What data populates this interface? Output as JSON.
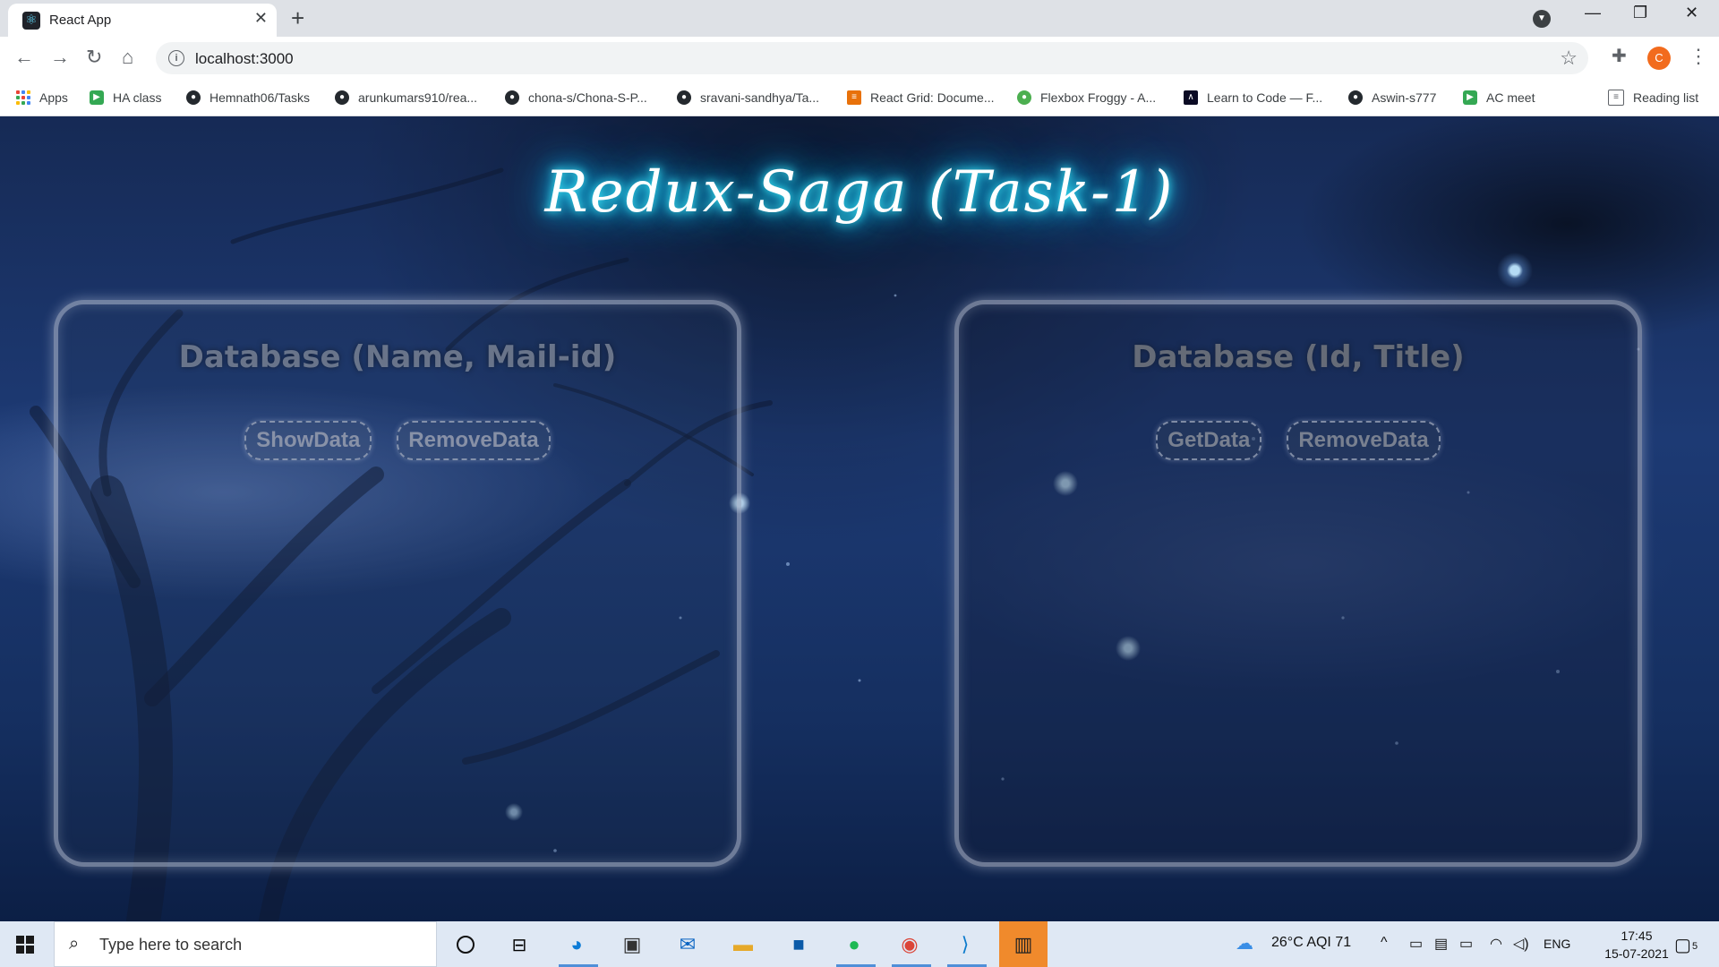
{
  "browser": {
    "tab_title": "React App",
    "tab_close": "✕",
    "new_tab": "+",
    "url": "localhost:3000",
    "profile_initial": "C",
    "window_controls": {
      "minimize": "—",
      "maximize": "❐",
      "close": "✕"
    }
  },
  "bookmarks": {
    "items": [
      {
        "label": "Apps",
        "icon": "apps-grid-icon"
      },
      {
        "label": "HA class",
        "icon": "google-meet-icon"
      },
      {
        "label": "Hemnath06/Tasks",
        "icon": "github-icon"
      },
      {
        "label": "arunkumars910/rea...",
        "icon": "github-icon"
      },
      {
        "label": "chona-s/Chona-S-P...",
        "icon": "github-icon"
      },
      {
        "label": "sravani-sandhya/Ta...",
        "icon": "github-icon"
      },
      {
        "label": "React Grid: Docume...",
        "icon": "ag-grid-icon"
      },
      {
        "label": "Flexbox Froggy - A...",
        "icon": "frog-icon"
      },
      {
        "label": "Learn to Code — F...",
        "icon": "freecodecamp-icon"
      },
      {
        "label": "Aswin-s777",
        "icon": "github-icon"
      },
      {
        "label": "AC meet",
        "icon": "google-meet-icon"
      }
    ],
    "reading_list": "Reading list"
  },
  "page": {
    "title": "Redux-Saga (Task-1)",
    "panels": [
      {
        "title": "Database (Name, Mail-id)",
        "buttons": [
          "ShowData",
          "RemoveData"
        ]
      },
      {
        "title": "Database (Id, Title)",
        "buttons": [
          "GetData",
          "RemoveData"
        ]
      }
    ]
  },
  "taskbar": {
    "search_placeholder": "Type here to search",
    "weather": "26°C  AQI 71",
    "language": "ENG",
    "time": "17:45",
    "date": "15-07-2021",
    "notification_count": "5"
  },
  "colors": {
    "title_glow": "#00d4ff",
    "taskbar_bg": "#dfe8f4",
    "avatar": "#f26b1d"
  }
}
